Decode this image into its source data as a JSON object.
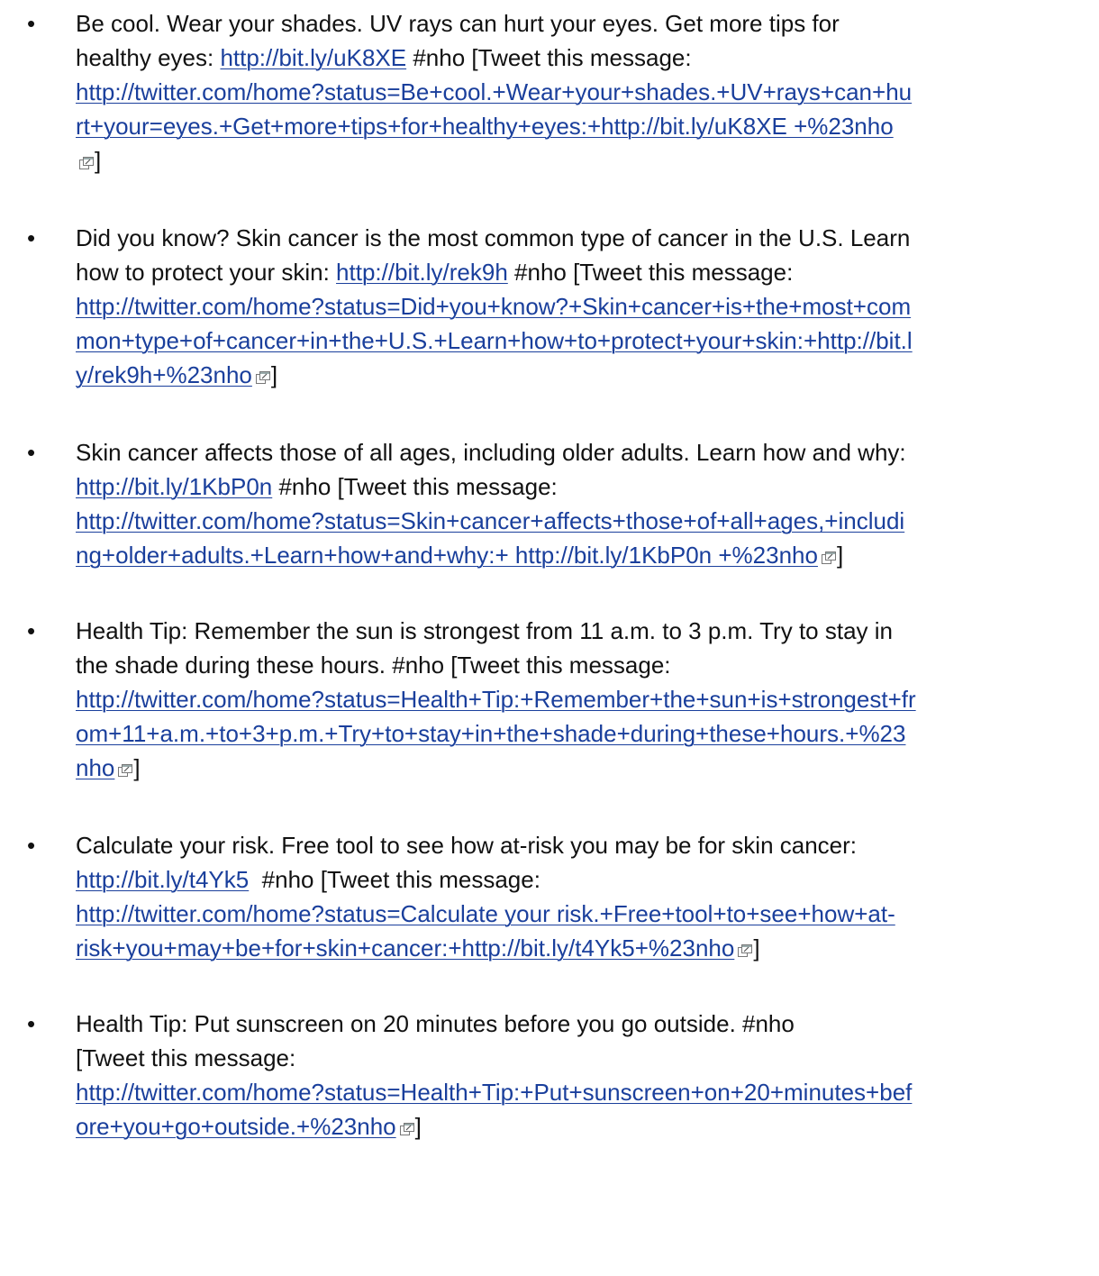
{
  "icons": {
    "external": "external-link-icon",
    "bullet": "bullet-icon"
  },
  "colors": {
    "link": "#1a3f9c",
    "text": "#111111"
  },
  "items": [
    {
      "bullet": "•",
      "l1a": "Be cool. Wear your shades. UV rays can hurt your eyes. Get more tips for",
      "l2a": "healthy eyes: ",
      "short_link": "http://bit.ly/uK8XE",
      "l2b": " #nho [Tweet this message:",
      "u1": "http://twitter.com/home?status=Be+cool.+Wear+your+shades.+UV+rays+can+hu",
      "u2": "rt+your=eyes.+Get+more+tips+for+healthy+eyes:+http://bit.ly/uK8XE +%23nho",
      "close": "]"
    },
    {
      "bullet": "•",
      "l1a": "Did you know? Skin cancer is the most common type of cancer in the U.S. Learn",
      "l2a": "how to protect your skin: ",
      "short_link": "http://bit.ly/rek9h",
      "l2b": " #nho [Tweet this message:",
      "u1": "http://twitter.com/home?status=Did+you+know?+Skin+cancer+is+the+most+com",
      "u2": "mon+type+of+cancer+in+the+U.S.+Learn+how+to+protect+your+skin:+http://bit.l",
      "u3": "y/rek9h+%23nho",
      "close": "]"
    },
    {
      "bullet": "•",
      "l1a": "Skin cancer affects those of all ages, including older adults. Learn how and why:",
      "short_link": "http://bit.ly/1KbP0n",
      "l2b": " #nho [Tweet this message:",
      "u1": "http://twitter.com/home?status=Skin+cancer+affects+those+of+all+ages,+includi",
      "u2": "ng+older+adults.+Learn+how+and+why:+ http://bit.ly/1KbP0n +%23nho",
      "close": "]"
    },
    {
      "bullet": "•",
      "l1a": "Health Tip: Remember the sun is strongest from 11 a.m. to 3 p.m. Try to stay in",
      "l2a": "the shade during these hours. #nho [Tweet this message:",
      "u1": "http://twitter.com/home?status=Health+Tip:+Remember+the+sun+is+strongest+fr",
      "u2": "om+11+a.m.+to+3+p.m.+Try+to+stay+in+the+shade+during+these+hours.+%23",
      "u3": "nho",
      "close": "]"
    },
    {
      "bullet": "•",
      "l1a": "Calculate your risk. Free tool to see how at-risk you may be for skin cancer:",
      "short_link": "http://bit.ly/t4Yk5",
      "l2b": "  #nho [Tweet this message:",
      "u1": "http://twitter.com/home?status=Calculate your risk.+Free+tool+to+see+how+at-",
      "u2": "risk+you+may+be+for+skin+cancer:+http://bit.ly/t4Yk5+%23nho",
      "close": "]"
    },
    {
      "bullet": "•",
      "l1a": "Health Tip: Put sunscreen on 20 minutes before you go outside. #nho",
      "l2a": "[Tweet this message:",
      "u1": "http://twitter.com/home?status=Health+Tip:+Put+sunscreen+on+20+minutes+bef",
      "u2": "ore+you+go+outside.+%23nho",
      "close": "]"
    }
  ]
}
